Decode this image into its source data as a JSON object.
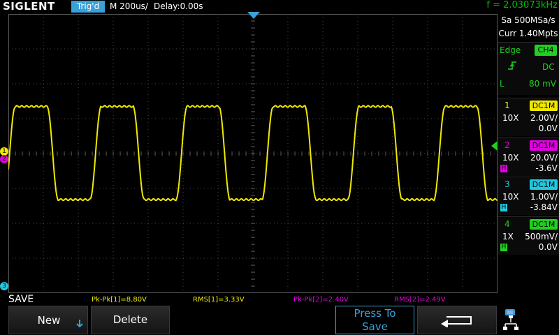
{
  "topbar": {
    "brand": "SIGLENT",
    "trigger_status": "Trig'd",
    "timebase": "M 200us/",
    "delay": "Delay:0.00s",
    "frequency": "f = 2.03073kHz"
  },
  "acquisition": {
    "sample_rate": "Sa 500MSa/s",
    "memory": "Curr 1.40Mpts"
  },
  "trigger": {
    "type": "Edge",
    "source": "CH4",
    "coupling": "DC",
    "level_label": "L",
    "level": "80 mV"
  },
  "channels": [
    {
      "num": "1",
      "coupling": "DC1M",
      "probe": "10X",
      "scale": "2.00V/",
      "offset": "0.0V",
      "color": "#f0e800",
      "bw": ""
    },
    {
      "num": "2",
      "coupling": "DC1M",
      "probe": "10X",
      "scale": "20.0V/",
      "offset": "-3.6V",
      "color": "#e000e0",
      "bw": "H"
    },
    {
      "num": "3",
      "coupling": "DC1M",
      "probe": "10X",
      "scale": "1.00V/",
      "offset": "-3.84V",
      "color": "#20c8e0",
      "bw": "H"
    },
    {
      "num": "4",
      "coupling": "DC1M",
      "probe": "1X",
      "scale": "500mV/",
      "offset": "0.0V",
      "color": "#20d020",
      "bw": "H"
    }
  ],
  "markers": {
    "ch1": "1",
    "ch2": "2",
    "ch3": "3"
  },
  "measurements": [
    {
      "text": "Pk-Pk[1]=8.80V",
      "color": "#f0e800"
    },
    {
      "text": "RMS[1]=3.33V",
      "color": "#f0e800"
    },
    {
      "text": "Pk-Pk[2]=2.40V",
      "color": "#e000e0"
    },
    {
      "text": "RMS[2]=2.49V",
      "color": "#e000e0"
    }
  ],
  "menu": {
    "title": "SAVE",
    "new_label": "New",
    "delete_label": "Delete",
    "press_line1": "Press To",
    "press_line2": "Save",
    "back_icon": "return-arrow-icon",
    "usb_icon": "usb-network-icon"
  },
  "colors": {
    "ch1": "#f0e800",
    "ch2": "#e000e0",
    "ch3": "#20c8e0",
    "ch4": "#20d020",
    "accent": "#3aa0d8"
  },
  "waveform": {
    "frequency_hz": 2030.73,
    "period_divisions": 2.46,
    "high_div": 1.35,
    "low_div": -1.32
  }
}
